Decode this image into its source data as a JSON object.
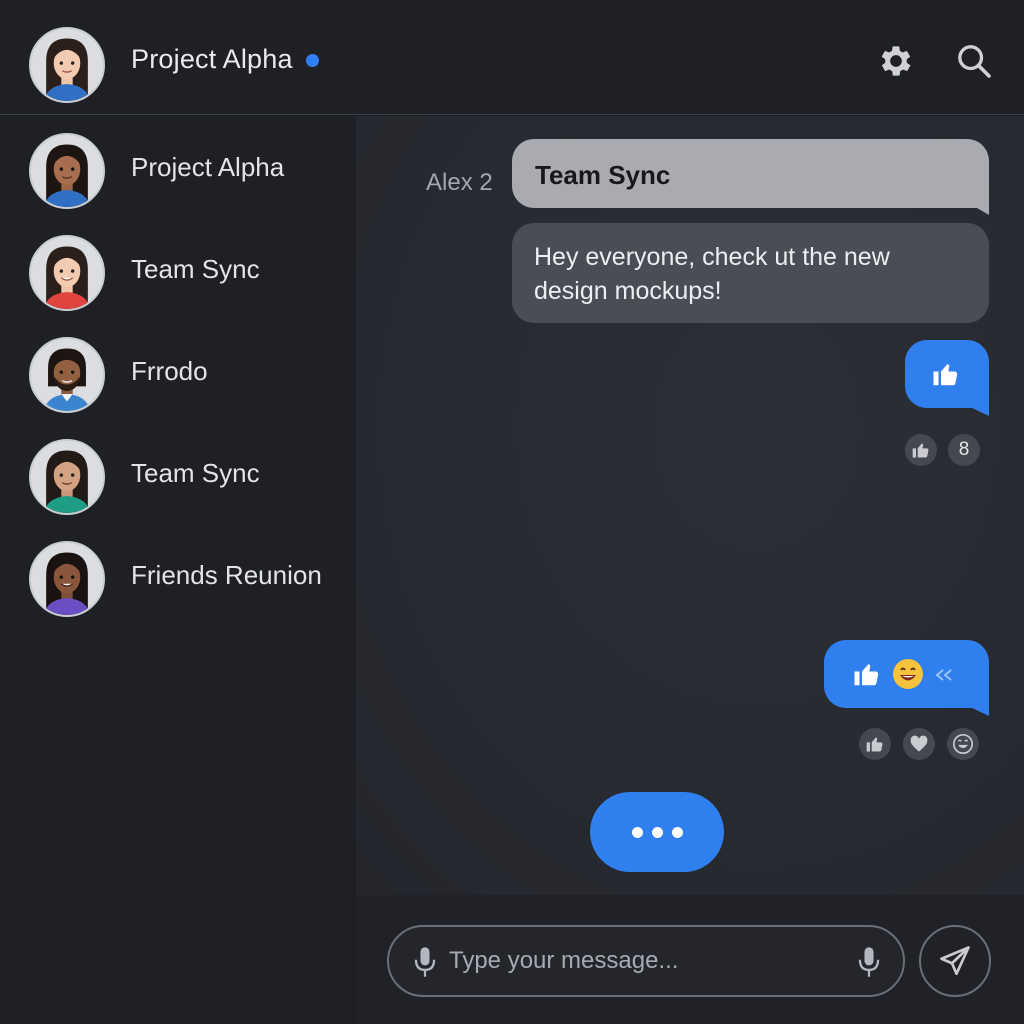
{
  "header": {
    "title": "Project Alpha",
    "online_color": "#2f80f2",
    "avatar_icon": "avatar-woman-icon",
    "settings_icon": "gear-icon",
    "search_icon": "search-icon"
  },
  "sidebar": {
    "items": [
      {
        "label": "Project Alpha",
        "avatar_icon": "avatar-woman-icon"
      },
      {
        "label": "Team Sync",
        "avatar_icon": "avatar-woman-icon"
      },
      {
        "label": "Frrodo",
        "avatar_icon": "avatar-man-icon"
      },
      {
        "label": "Team Sync",
        "avatar_icon": "avatar-woman-icon"
      },
      {
        "label": "Friends Reunion",
        "avatar_icon": "avatar-woman-icon"
      }
    ]
  },
  "chat": {
    "sender": "Alex 2",
    "title_bubble": "Team Sync",
    "message": "Hey everyone, check ut the new design mockups!",
    "like_bubble_icon": "thumbs-up-icon",
    "like_reaction_count": "8",
    "emoji_bubble_icons": [
      "thumbs-up-icon",
      "grinning-emoji-icon",
      "read-receipt-icon"
    ],
    "reactions": [
      "thumbs-up-icon",
      "heart-icon",
      "laugh-icon"
    ],
    "typing_indicator": "typing-dots"
  },
  "composer": {
    "placeholder": "Type your message...",
    "value": "",
    "mic_icon": "microphone-icon",
    "send_icon": "send-icon"
  },
  "colors": {
    "accent": "#2f80ee",
    "background": "#1c1e23",
    "incoming_bubble": "#4a4d54",
    "title_bubble": "#a9abb0"
  }
}
